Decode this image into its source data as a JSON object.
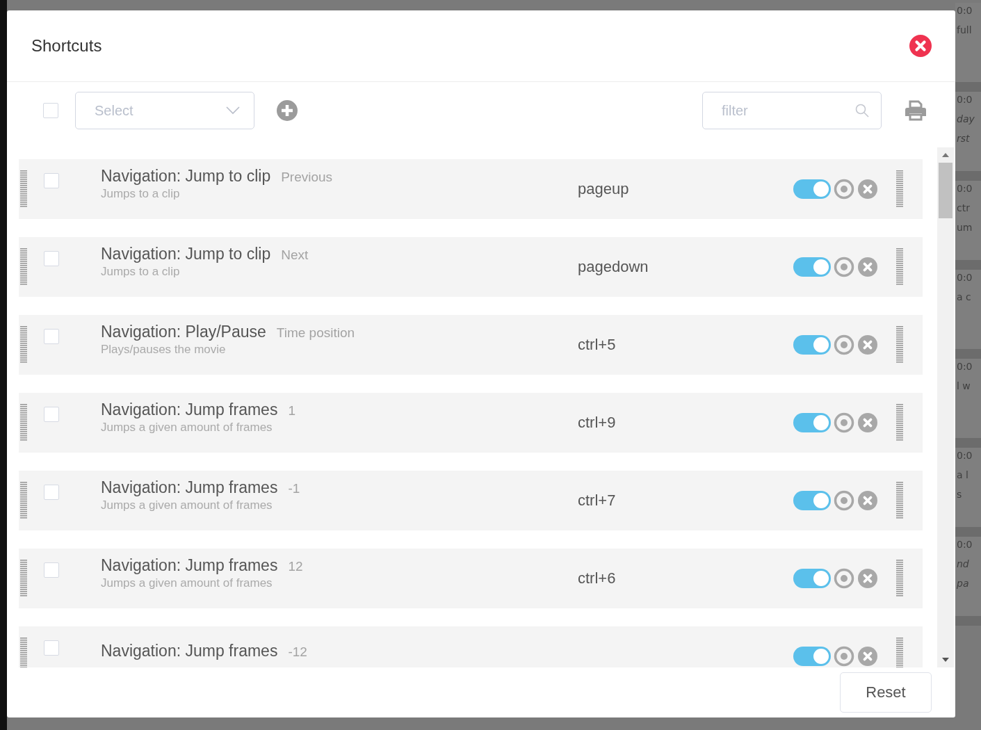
{
  "window": {
    "title": "Shortcuts"
  },
  "toolbar": {
    "select_all_checked": false,
    "select": {
      "placeholder": "Select"
    },
    "filter": {
      "placeholder": "filter"
    }
  },
  "shortcuts": [
    {
      "name": "Navigation: Jump to clip",
      "param": "Previous",
      "description": "Jumps to a clip",
      "key": "pageup",
      "enabled": true,
      "checked": false
    },
    {
      "name": "Navigation: Jump to clip",
      "param": "Next",
      "description": "Jumps to a clip",
      "key": "pagedown",
      "enabled": true,
      "checked": false
    },
    {
      "name": "Navigation: Play/Pause",
      "param": "Time position",
      "description": "Plays/pauses the movie",
      "key": "ctrl+5",
      "enabled": true,
      "checked": false
    },
    {
      "name": "Navigation: Jump frames",
      "param": "1",
      "description": "Jumps a given amount of frames",
      "key": "ctrl+9",
      "enabled": true,
      "checked": false
    },
    {
      "name": "Navigation: Jump frames",
      "param": "-1",
      "description": "Jumps a given amount of frames",
      "key": "ctrl+7",
      "enabled": true,
      "checked": false
    },
    {
      "name": "Navigation: Jump frames",
      "param": "12",
      "description": "Jumps a given amount of frames",
      "key": "ctrl+6",
      "enabled": true,
      "checked": false
    },
    {
      "name": "Navigation: Jump frames",
      "param": "-12",
      "enabled": true,
      "checked": false
    }
  ],
  "buttons": [
    {
      "label": "Reset"
    }
  ],
  "background": {
    "groups": [
      {
        "items": [
          {
            "text": "0:0",
            "italic": false
          },
          {
            "text": "full",
            "italic": false
          }
        ]
      },
      {
        "items": [
          {
            "text": "0:0",
            "italic": false
          },
          {
            "text": "day",
            "italic": true
          },
          {
            "text": "rst",
            "italic": true
          }
        ]
      },
      {
        "items": [
          {
            "text": "0:0",
            "italic": false
          },
          {
            "text": "ctr",
            "italic": false
          },
          {
            "text": "um",
            "italic": false
          }
        ]
      },
      {
        "items": [
          {
            "text": "0:0",
            "italic": false
          },
          {
            "text": "a c",
            "italic": false
          }
        ]
      },
      {
        "items": [
          {
            "text": "0:0",
            "italic": false
          },
          {
            "text": "l w",
            "italic": false
          }
        ]
      },
      {
        "items": [
          {
            "text": "0:0",
            "italic": false
          },
          {
            "text": "a l",
            "italic": false
          },
          {
            "text": "s",
            "italic": false
          }
        ]
      },
      {
        "items": [
          {
            "text": "0:0",
            "italic": false
          },
          {
            "text": "nd",
            "italic": true
          },
          {
            "text": "pa",
            "italic": true
          }
        ]
      }
    ]
  }
}
